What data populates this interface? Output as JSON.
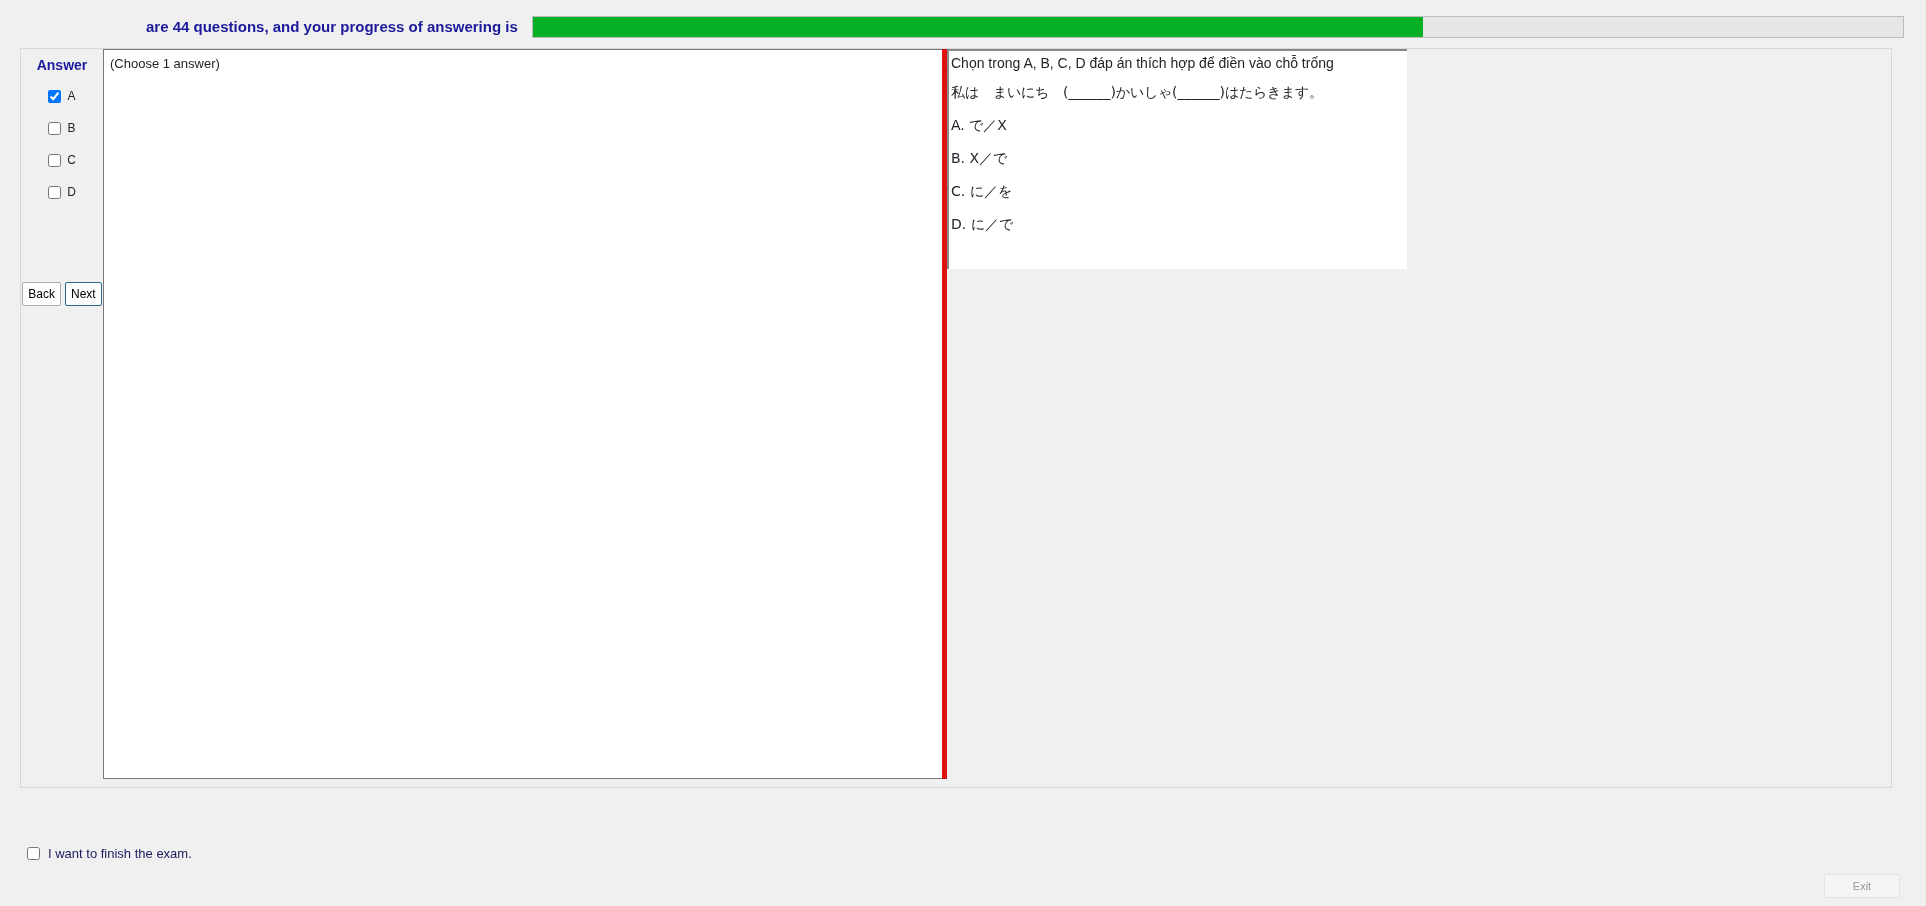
{
  "header": {
    "progress_text": "are 44 questions, and your progress of answering is",
    "progress": {
      "level": 0.65
    }
  },
  "answer_panel": {
    "title": "Answer",
    "options": [
      {
        "label": "A",
        "checked": true
      },
      {
        "label": "B",
        "checked": false
      },
      {
        "label": "C",
        "checked": false
      },
      {
        "label": "D",
        "checked": false
      }
    ],
    "buttons": [
      {
        "label": "Back",
        "focused": false
      },
      {
        "label": "Next",
        "focused": true
      }
    ]
  },
  "left_pane": {
    "instruction": "(Choose 1 answer)"
  },
  "question": {
    "lines": [
      "Chọn trong A, B, C, D đáp án thích hợp để điền vào chỗ trống",
      "私は　まいにち　(______)かいしゃ(______)はたらきます。",
      "A.  で／X",
      "B.  X／で",
      "C.  に／を",
      "D.  に／で"
    ]
  },
  "finish": {
    "label": "I want to finish the exam.",
    "checked": false
  },
  "exit_button": {
    "label": "Exit",
    "disabled": true
  }
}
